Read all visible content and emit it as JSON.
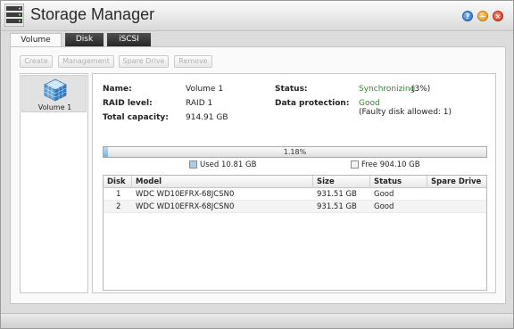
{
  "window": {
    "title": "Storage Manager",
    "help_label": "?",
    "minimize_label": "−",
    "close_label": "×"
  },
  "tabs": [
    {
      "label": "Volume",
      "active": true
    },
    {
      "label": "Disk",
      "active": false
    },
    {
      "label": "iSCSI",
      "active": false
    }
  ],
  "toolbar": {
    "create_label": "Create",
    "management_label": "Management",
    "spare_drive_label": "Spare Drive",
    "remove_label": "Remove"
  },
  "volumes": [
    {
      "label": "Volume 1",
      "icon": "volume-cube-icon"
    }
  ],
  "details": {
    "name_label": "Name:",
    "name_value": "Volume 1",
    "raid_label": "RAID level:",
    "raid_value": "RAID 1",
    "capacity_label": "Total capacity:",
    "capacity_value": "914.91 GB",
    "status_label": "Status:",
    "status_value": "Synchronizing",
    "status_progress": "(3%)",
    "protection_label": "Data protection:",
    "protection_value": "Good",
    "protection_note": "(Faulty disk allowed: 1)"
  },
  "usage": {
    "percent_text": "1.18%",
    "fraction": 0.0118,
    "used_label": "Used 10.81 GB",
    "free_label": "Free 904.10 GB"
  },
  "disk_table": {
    "headers": [
      "Disk",
      "Model",
      "Size",
      "Status",
      "Spare Drive"
    ],
    "rows": [
      [
        "1",
        "WDC WD10EFRX-68JCSN0",
        "931.51 GB",
        "Good",
        ""
      ],
      [
        "2",
        "WDC WD10EFRX-68JCSN0",
        "931.51 GB",
        "Good",
        ""
      ]
    ]
  },
  "colors": {
    "status_green": "#2c8a2c",
    "used_swatch": "#a9cdec",
    "free_swatch": "#f4f4f4"
  }
}
